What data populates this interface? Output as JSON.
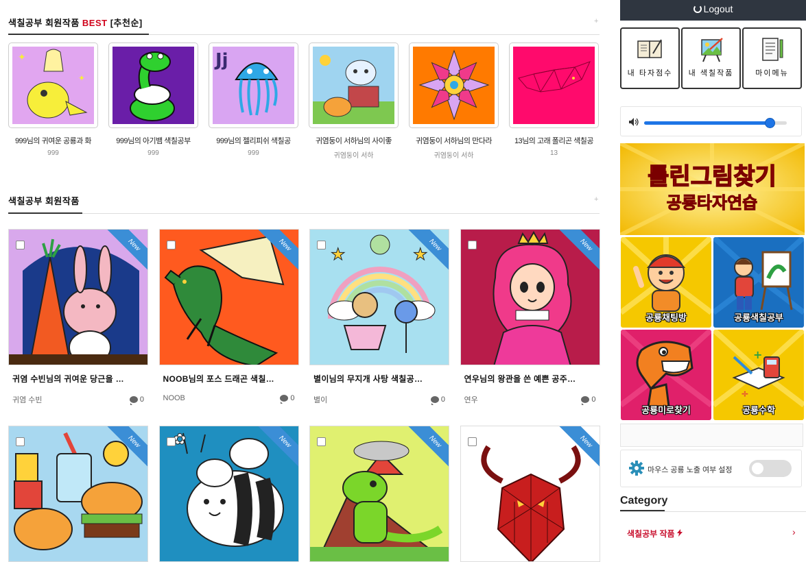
{
  "best_section": {
    "title_main": "색칠공부 회원작품",
    "title_best": "BEST",
    "title_sort": "[추천순]",
    "plus": "+",
    "items": [
      {
        "caption": "999님의 귀여운 공룡과 화",
        "author": "999",
        "bg": "#e1a6f0"
      },
      {
        "caption": "999님의 아기뱀 색칠공부",
        "author": "999",
        "bg": "#6a1ea8"
      },
      {
        "caption": "999님의 젤리피쉬 색칠공",
        "author": "999",
        "bg": "#d9a5f2"
      },
      {
        "caption": "귀염둥이 서하님의 사이좋",
        "author": "귀염둥이 서하",
        "bg": "#9fd4f0"
      },
      {
        "caption": "귀염둥이 서하님의 만다라",
        "author": "귀염둥이 서하",
        "bg": "#ff7a00"
      },
      {
        "caption": "13님의 고래 폴리곤 색칠공",
        "author": "13",
        "bg": "#ff0a6c"
      }
    ]
  },
  "member_section": {
    "title": "색칠공부 회원작품",
    "plus": "+",
    "new_label": "New",
    "cards": [
      {
        "title": "귀염 수빈님의 귀여운 당근을 …",
        "author": "귀염 수빈",
        "comments": "0",
        "bg": "#d8a8ec"
      },
      {
        "title": "NOOB님의 포스 드래곤 색칠…",
        "author": "NOOB",
        "comments": "0",
        "bg": "#ff5a1f"
      },
      {
        "title": "별이님의 무지개 사탕 색칠공…",
        "author": "별이",
        "comments": "0",
        "bg": "#a8e0f0"
      },
      {
        "title": "연우님의 왕관을 쓴 예쁜 공주…",
        "author": "연우",
        "comments": "0",
        "bg": "#b81c4a"
      },
      {
        "title": "",
        "author": "",
        "comments": "",
        "bg": "#a8d8f0"
      },
      {
        "title": "",
        "author": "",
        "comments": "",
        "bg": "#1f8fc0"
      },
      {
        "title": "",
        "author": "",
        "comments": "",
        "bg": "#e0f070"
      },
      {
        "title": "",
        "author": "",
        "comments": "",
        "bg": "#ffffff"
      }
    ]
  },
  "sidebar": {
    "logout": "Logout",
    "menu": [
      {
        "label": "내 타자점수",
        "icon": "book-pen-icon"
      },
      {
        "label": "내 색칠작품",
        "icon": "easel-icon"
      },
      {
        "label": "마이메뉴",
        "icon": "notepad-icon"
      }
    ],
    "volume": 0.88,
    "banner_line1": "틀린그림찾기",
    "banner_line2": "공룡타자연습",
    "tiles": [
      {
        "label": "공룡채팅방",
        "bg": "#f5c800"
      },
      {
        "label": "공룡색칠공부",
        "bg": "#1a6fc0"
      },
      {
        "label": "공룡미로찾기",
        "bg": "#e0206a"
      },
      {
        "label": "공룡수학",
        "bg": "#f5c800"
      }
    ],
    "mouse_setting_label": "마우스 공룡 노출 여부 설정",
    "mouse_toggle_on": false,
    "category_title": "Category",
    "category_item": "색칠공부 작품",
    "category_arrow": "›"
  }
}
